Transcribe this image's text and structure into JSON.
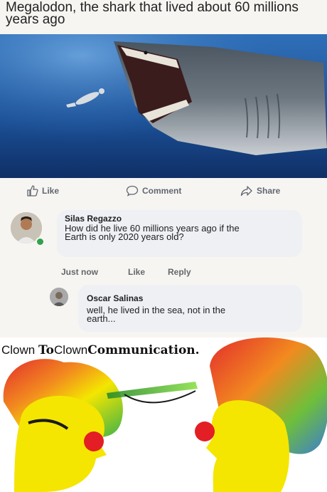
{
  "post": {
    "title": "Megalodon, the shark that lived about 60 millions years ago"
  },
  "actions": {
    "like_label": "Like",
    "comment_label": "Comment",
    "share_label": "Share",
    "like_icon": "thumbs-up-icon",
    "comment_icon": "speech-bubble-icon",
    "share_icon": "share-arrow-icon"
  },
  "comments": [
    {
      "author": "Silas Regazzo",
      "text": "How did he live 60 millions years ago if the Earth is only 2020 years old?",
      "time": "Just now",
      "like_label": "Like",
      "reply_label": "Reply"
    },
    {
      "author": "Oscar Salinas",
      "text": "well, he lived in the sea, not in the earth..."
    }
  ],
  "meme": {
    "caption_part1": "Clown ",
    "caption_part2": "To",
    "caption_part3": "Clown",
    "caption_part4": "Communication."
  },
  "colors": {
    "ocean": "#1f4d8c",
    "bubble": "#eef0f3",
    "clown_nose": "#e31e24",
    "clown_skin": "#f4e600"
  }
}
